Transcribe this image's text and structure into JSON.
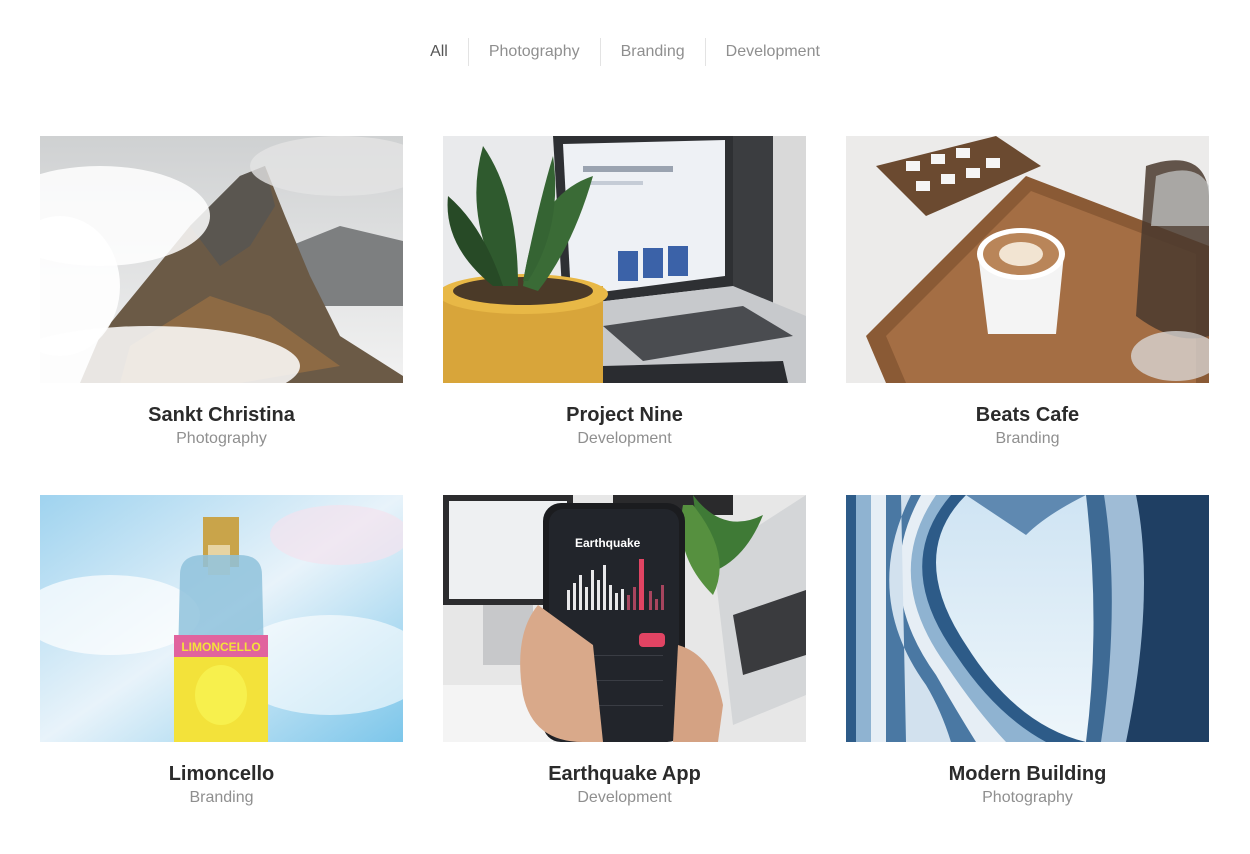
{
  "filters": [
    "All",
    "Photography",
    "Branding",
    "Development"
  ],
  "active_filter": "All",
  "projects": [
    {
      "title": "Sankt Christina",
      "category": "Photography",
      "image": "mountain-photo"
    },
    {
      "title": "Project Nine",
      "category": "Development",
      "image": "laptop-plant-photo"
    },
    {
      "title": "Beats Cafe",
      "category": "Branding",
      "image": "coffee-tray-photo"
    },
    {
      "title": "Limoncello",
      "category": "Branding",
      "image": "limoncello-bottle-photo",
      "label_text": "LIMONCELLO"
    },
    {
      "title": "Earthquake App",
      "category": "Development",
      "image": "phone-app-photo",
      "screen_title": "Earthquake"
    },
    {
      "title": "Modern Building",
      "category": "Photography",
      "image": "architecture-photo"
    }
  ]
}
